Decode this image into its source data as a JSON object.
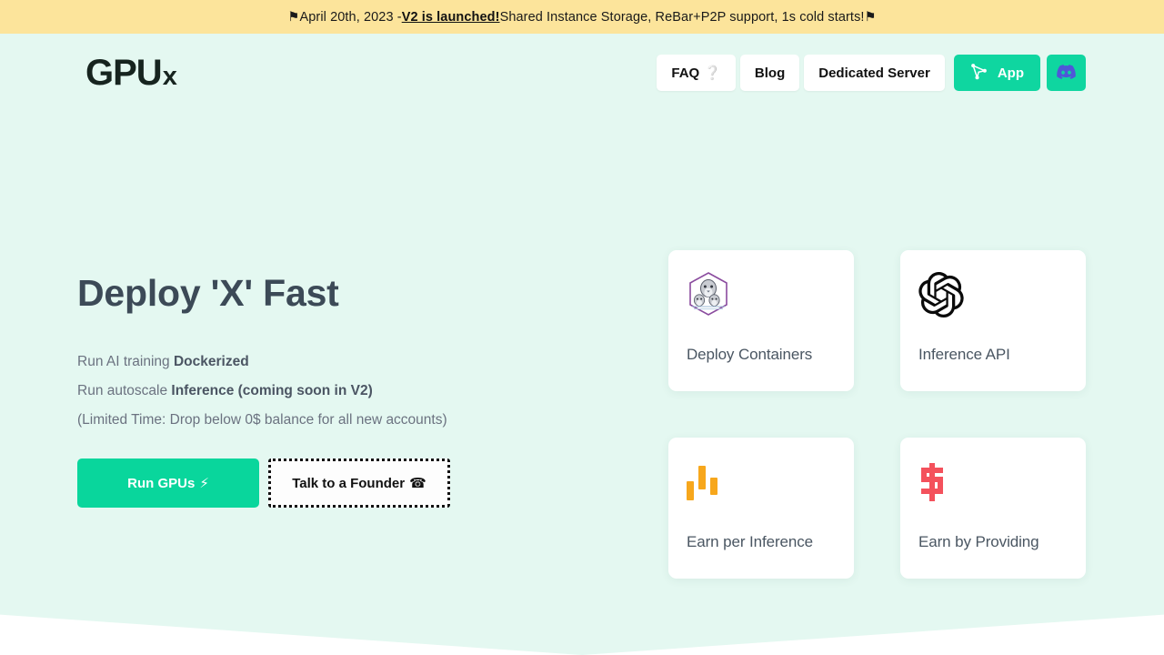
{
  "banner": {
    "lead_icon": "⚑",
    "date_text": "April 20th, 2023 - ",
    "link_label": "V2 is launched!",
    "rest_text": " Shared Instance Storage, ReBar+P2P support, 1s cold starts! ",
    "trail_icon": "⚑",
    "background": "#FCE49B"
  },
  "nav": {
    "logo_main": "GPU",
    "logo_sub": "x",
    "buttons": [
      {
        "label": "FAQ",
        "icon": "❔",
        "name": "faq"
      },
      {
        "label": "Blog",
        "icon": "",
        "name": "blog"
      },
      {
        "label": "Dedicated Server",
        "icon": "",
        "name": "dedicated-server"
      }
    ],
    "app_button": {
      "label": "App",
      "icon": "share-nodes-icon"
    },
    "discord_button": {
      "label": "Discord",
      "icon": "discord-icon",
      "color": "#4F57D8"
    },
    "accent": "#0FD6A0"
  },
  "hero": {
    "heading": "Deploy 'X' Fast",
    "line1_pre": "Run AI training ",
    "line1_bold": "Dockerized",
    "line2_pre": "Run autoscale ",
    "line2_bold": "Inference (coming soon in V2)",
    "line3": "(Limited Time: Drop below 0$ balance for all new accounts)",
    "cta_primary": {
      "label": "Run GPUs",
      "icon": "⚡"
    },
    "cta_secondary": {
      "label": "Talk to a Founder",
      "icon": "☎"
    },
    "background": "#E4F8F1"
  },
  "cards": [
    {
      "title": "Deploy Containers",
      "icon": "podman-seal-icon"
    },
    {
      "title": "Inference API",
      "icon": "openai-logo-icon"
    },
    {
      "title": "Earn per Inference",
      "icon": "candlestick-bars-icon"
    },
    {
      "title": "Earn by Providing",
      "icon": "dollar-sign-icon"
    }
  ]
}
